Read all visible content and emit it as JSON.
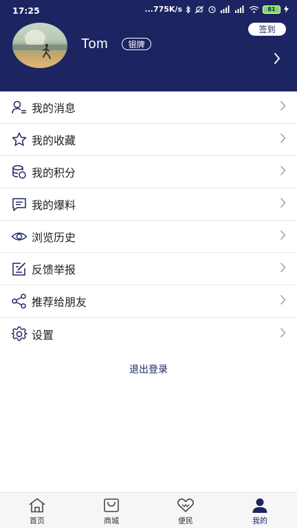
{
  "status_bar": {
    "time": "17:25",
    "network_speed": "...775K/s",
    "battery_level": "81"
  },
  "profile": {
    "username": "Tom",
    "level_badge": "银牌",
    "checkin_label": "签到"
  },
  "menu": {
    "items": [
      {
        "label": "我的消息",
        "icon": "user-list-icon"
      },
      {
        "label": "我的收藏",
        "icon": "star-icon"
      },
      {
        "label": "我的积分",
        "icon": "coins-icon"
      },
      {
        "label": "我的爆料",
        "icon": "chat-icon"
      },
      {
        "label": "浏览历史",
        "icon": "eye-icon"
      },
      {
        "label": "反馈举报",
        "icon": "edit-icon"
      },
      {
        "label": "推荐给朋友",
        "icon": "share-icon"
      },
      {
        "label": "设置",
        "icon": "gear-icon"
      }
    ]
  },
  "logout_label": "退出登录",
  "bottom_nav": {
    "items": [
      {
        "label": "首页",
        "icon": "home-icon",
        "active": false
      },
      {
        "label": "商城",
        "icon": "shopping-bag-icon",
        "active": false
      },
      {
        "label": "便民",
        "icon": "heart-icon",
        "active": false
      },
      {
        "label": "我的",
        "icon": "person-icon",
        "active": true
      }
    ]
  },
  "colors": {
    "header_bg": "#1c2461",
    "accent": "#1c2461",
    "battery": "#7ed957"
  }
}
